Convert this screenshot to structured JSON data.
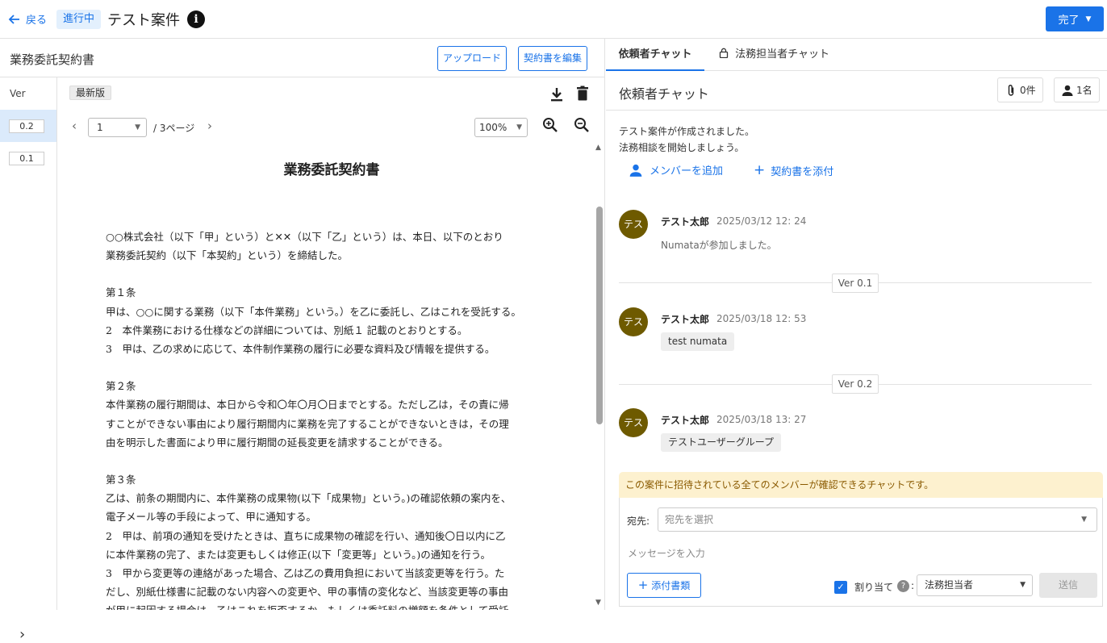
{
  "header": {
    "back_label": "戻る",
    "status": "進行中",
    "title": "テスト案件",
    "done_label": "完了"
  },
  "document": {
    "title": "業務委託契約書",
    "upload_label": "アップロード",
    "edit_label": "契約書を編集",
    "ver_heading": "Ver",
    "versions": [
      "0.2",
      "0.1"
    ],
    "latest_tag": "最新版",
    "page_value": "1",
    "page_total": "/ 3ページ",
    "zoom_value": "100%",
    "doc_heading": "業務委託契約書",
    "lines": [
      "○○株式会社（以下「甲」という）と✕✕（以下「乙」という）は、本日、以下のとおり",
      "業務委託契約（以下「本契約」という）を締結した。",
      "",
      "第１条",
      "甲は、○○に関する業務（以下「本件業務」という。）を乙に委託し、乙はこれを受託する。",
      "2　本件業務における仕様などの詳細については、別紙１ 記載のとおりとする。",
      "3　甲は、乙の求めに応じて、本件制作業務の履行に必要な資料及び情報を提供する。",
      "",
      "第２条",
      "本件業務の履行期間は、本日から令和〇年〇月〇日までとする。ただし乙は，その責に帰",
      "すことができない事由により履行期間内に業務を完了することができないときは，その理",
      "由を明示した書面により甲に履行期間の延長変更を請求することができる。",
      "",
      "第３条",
      "乙は、前条の期間内に、本件業務の成果物(以下「成果物」という。)の確認依頼の案内を、",
      "電子メール等の手段によって、甲に通知する。",
      "2　甲は、前項の通知を受けたときは、直ちに成果物の確認を行い、通知後〇日以内に乙",
      "に本件業務の完了、または変更もしくは修正(以下「変更等」という。)の通知を行う。",
      "3　甲から変更等の連絡があった場合、乙は乙の費用負担において当該変更等を行う。た",
      "だし、別紙仕様書に記載のない内容への変更や、甲の事情の変化など、当該変更等の事由",
      "が甲に起因する場合は、乙はこれを拒否するか、もしくは委託料の増額を条件として受託"
    ]
  },
  "chat": {
    "tab_client": "依頼者チャット",
    "tab_legal": "法務担当者チャット",
    "title": "依頼者チャット",
    "attachments_count": "0件",
    "members_count": "1名",
    "system_line1": "テスト案件が作成されました。",
    "system_line2": "法務相談を開始しましょう。",
    "add_member_label": "メンバーを追加",
    "attach_contract_label": "契約書を添付",
    "messages": [
      {
        "avatar": "テス",
        "name": "テスト太郎",
        "time": "2025/03/12 12: 24",
        "text": "Numataが参加しました。"
      },
      {
        "avatar": "テス",
        "name": "テスト太郎",
        "time": "2025/03/18 12: 53",
        "text": "test numata"
      },
      {
        "avatar": "テス",
        "name": "テスト太郎",
        "time": "2025/03/18 13: 27",
        "text": "テストユーザーグループ"
      }
    ],
    "version_markers": [
      "Ver 0.1",
      "Ver 0.2"
    ],
    "notice": "この案件に招待されている全てのメンバーが確認できるチャットです。",
    "to_label": "宛先:",
    "to_placeholder": "宛先を選択",
    "message_placeholder": "メッセージを入力",
    "attach_docs_label": "添付書類",
    "assign_label": "割り当て",
    "assign_value": "法務担当者",
    "send_label": "送信"
  },
  "colors": {
    "accent": "#1a73e8",
    "avatar": "#6e5a00",
    "notice_bg": "#fdf1cf"
  }
}
